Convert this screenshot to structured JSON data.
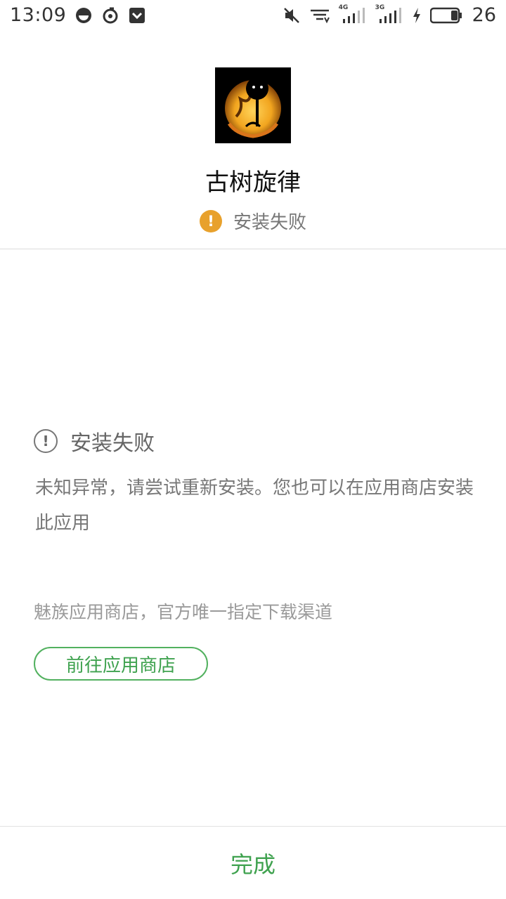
{
  "status_bar": {
    "time": "13:09",
    "signal_1_type": "4G",
    "signal_2_type": "3G",
    "battery": "26",
    "icons": [
      "app-notification-icon",
      "netease-music-icon",
      "pocket-icon",
      "mute-icon",
      "wifi-icon",
      "signal-4g-icon",
      "signal-3g-icon",
      "charging-icon",
      "battery-icon"
    ]
  },
  "app": {
    "name": "古树旋律",
    "icon": "ancient-tree-melody-app-icon",
    "status": "安装失败"
  },
  "error": {
    "title": "安装失败",
    "message": "未知异常，请尝试重新安装。您也可以在应用商店安装此应用"
  },
  "store": {
    "note": "魅族应用商店，官方唯一指定下载渠道",
    "button_label": "前往应用商店"
  },
  "footer": {
    "done_label": "完成"
  },
  "colors": {
    "accent_green": "#3fa24f",
    "warning_orange": "#e8a12c"
  }
}
